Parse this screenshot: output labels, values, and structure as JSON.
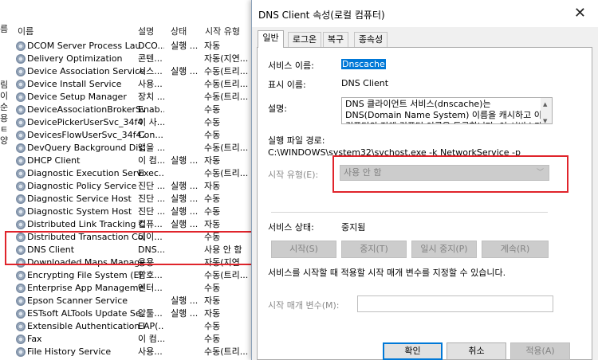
{
  "services": {
    "left_strip_chars": [
      "름",
      "",
      "",
      "",
      "",
      "림",
      "이",
      "순",
      "용",
      "ㅌ",
      "양"
    ],
    "columns": {
      "name": "이름",
      "desc": "설명",
      "status": "상태",
      "startup": "시작 유형"
    },
    "rows": [
      {
        "name": "DCOM Server Process Lau...",
        "desc": "DCO...",
        "status": "실행 ...",
        "startup": "자동"
      },
      {
        "name": "Delivery Optimization",
        "desc": "콘텐...",
        "status": "",
        "startup": "자동(지연..."
      },
      {
        "name": "Device Association Service",
        "desc": "시스...",
        "status": "실행 ...",
        "startup": "수동(트리..."
      },
      {
        "name": "Device Install Service",
        "desc": "사용...",
        "status": "",
        "startup": "수동(트리..."
      },
      {
        "name": "Device Setup Manager",
        "desc": "장치 ...",
        "status": "",
        "startup": "수동(트리..."
      },
      {
        "name": "DeviceAssociationBrokerSv...",
        "desc": "Enab...",
        "status": "",
        "startup": "수동"
      },
      {
        "name": "DevicePickerUserSvc_34f47",
        "desc": "이 사...",
        "status": "",
        "startup": "수동"
      },
      {
        "name": "DevicesFlowUserSvc_34f47",
        "desc": "Con...",
        "status": "",
        "startup": "수동"
      },
      {
        "name": "DevQuery Background Dis...",
        "desc": "앱을 ...",
        "status": "",
        "startup": "수동(트리..."
      },
      {
        "name": "DHCP Client",
        "desc": "이 컴...",
        "status": "실행 ...",
        "startup": "자동"
      },
      {
        "name": "Diagnostic Execution Service",
        "desc": "Exec...",
        "status": "",
        "startup": "수동(트리..."
      },
      {
        "name": "Diagnostic Policy Service",
        "desc": "진단 ...",
        "status": "실행 ...",
        "startup": "자동"
      },
      {
        "name": "Diagnostic Service Host",
        "desc": "진단 ...",
        "status": "실행 ...",
        "startup": "수동"
      },
      {
        "name": "Diagnostic System Host",
        "desc": "진단 ...",
        "status": "실행 ...",
        "startup": "수동"
      },
      {
        "name": "Distributed Link Tracking C...",
        "desc": "컴퓨...",
        "status": "실행 ...",
        "startup": "자동"
      },
      {
        "name": "Distributed Transaction Co...",
        "desc": "데이...",
        "status": "",
        "startup": "수동"
      },
      {
        "name": "DNS Client",
        "desc": "DNS...",
        "status": "",
        "startup": "사용 안 함"
      },
      {
        "name": "Downloaded Maps Manager",
        "desc": "응용...",
        "status": "",
        "startup": "자동(지연..."
      },
      {
        "name": "Encrypting File System (EFS)",
        "desc": "암호...",
        "status": "",
        "startup": "수동(트리..."
      },
      {
        "name": "Enterprise App Manageme...",
        "desc": "엔터...",
        "status": "",
        "startup": "수동"
      },
      {
        "name": "Epson Scanner Service",
        "desc": "",
        "status": "실행 ...",
        "startup": "자동"
      },
      {
        "name": "ESTsoft ALTools Update Se...",
        "desc": "알툴...",
        "status": "실행 ...",
        "startup": "자동"
      },
      {
        "name": "Extensible Authentication P...",
        "desc": "EAP(...",
        "status": "",
        "startup": "수동"
      },
      {
        "name": "Fax",
        "desc": "이 컴...",
        "status": "",
        "startup": "수동"
      },
      {
        "name": "File History Service",
        "desc": "사용...",
        "status": "",
        "startup": "수동(트리..."
      }
    ]
  },
  "dialog": {
    "title": "DNS Client 속성(로컬 컴퓨터)",
    "close_glyph": "✕",
    "tabs": [
      "일반",
      "로그온",
      "복구",
      "종속성"
    ],
    "service_name_label": "서비스 이름:",
    "service_name_value": "Dnscache",
    "display_name_label": "표시 이름:",
    "display_name_value": "DNS Client",
    "description_label": "설명:",
    "description_value": "DNS 클라이언트 서비스(dnscache)는 DNS(Domain Name System) 이름을 캐시하고 이 컴퓨터의 전체 컴퓨터 이름을 등록합니다. 이 서비스가 중지되어도",
    "exe_path_label": "실행 파일 경로:",
    "exe_path_value": "C:\\WINDOWS\\system32\\svchost.exe -k NetworkService -p",
    "startup_type_label": "시작 유형(E):",
    "startup_type_value": "사용 안 함",
    "service_status_label": "서비스 상태:",
    "service_status_value": "중지됨",
    "buttons": {
      "start": "시작(S)",
      "stop": "중지(T)",
      "pause": "일시 중지(P)",
      "resume": "계속(R)"
    },
    "hint": "서비스를 시작할 때 적용할 시작 매개 변수를 지정할 수 있습니다.",
    "start_params_label": "시작 매개 변수(M):",
    "start_params_value": "",
    "footer": {
      "ok": "확인",
      "cancel": "취소",
      "apply": "적용(A)"
    }
  },
  "colors": {
    "highlight_box": "#e0242b",
    "selection": "#0078d7"
  }
}
